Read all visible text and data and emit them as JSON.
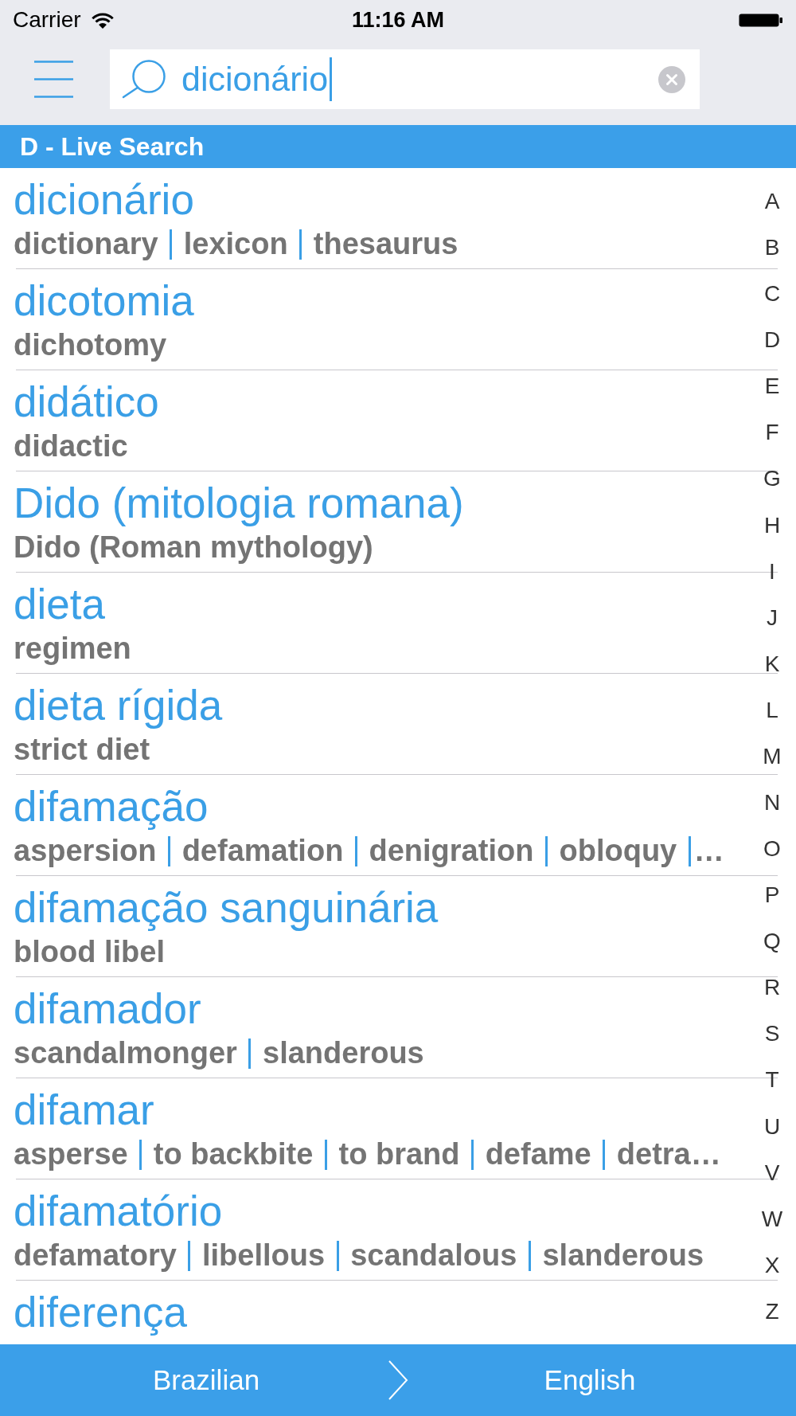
{
  "status_bar": {
    "carrier": "Carrier",
    "time": "11:16 AM"
  },
  "search": {
    "value": "dicionário"
  },
  "section_header": "D - Live Search",
  "entries": [
    {
      "headword": "dicionário",
      "translations": [
        "dictionary",
        "lexicon",
        "thesaurus"
      ]
    },
    {
      "headword": "dicotomia",
      "translations": [
        "dichotomy"
      ]
    },
    {
      "headword": "didático",
      "translations": [
        "didactic"
      ]
    },
    {
      "headword": "Dido (mitologia romana)",
      "translations": [
        "Dido (Roman mythology)"
      ]
    },
    {
      "headword": "dieta",
      "translations": [
        "regimen"
      ]
    },
    {
      "headword": "dieta rígida",
      "translations": [
        "strict diet"
      ]
    },
    {
      "headword": "difamação",
      "translations": [
        "aspersion",
        "defamation",
        "denigration",
        "obloquy"
      ],
      "more": "…"
    },
    {
      "headword": "difamação sanguinária",
      "translations": [
        "blood libel"
      ]
    },
    {
      "headword": "difamador",
      "translations": [
        "scandalmonger",
        "slanderous"
      ]
    },
    {
      "headword": "difamar",
      "translations": [
        "asperse",
        "to backbite",
        "to brand",
        "defame",
        "detra…"
      ]
    },
    {
      "headword": "difamatório",
      "translations": [
        "defamatory",
        "libellous",
        "scandalous",
        "slanderous"
      ]
    },
    {
      "headword": "diferença"
    }
  ],
  "index_letters": [
    "A",
    "B",
    "C",
    "D",
    "E",
    "F",
    "G",
    "H",
    "I",
    "J",
    "K",
    "L",
    "M",
    "N",
    "O",
    "P",
    "Q",
    "R",
    "S",
    "T",
    "U",
    "V",
    "W",
    "X",
    "Z"
  ],
  "language_bar": {
    "source": "Brazilian",
    "target": "English"
  }
}
